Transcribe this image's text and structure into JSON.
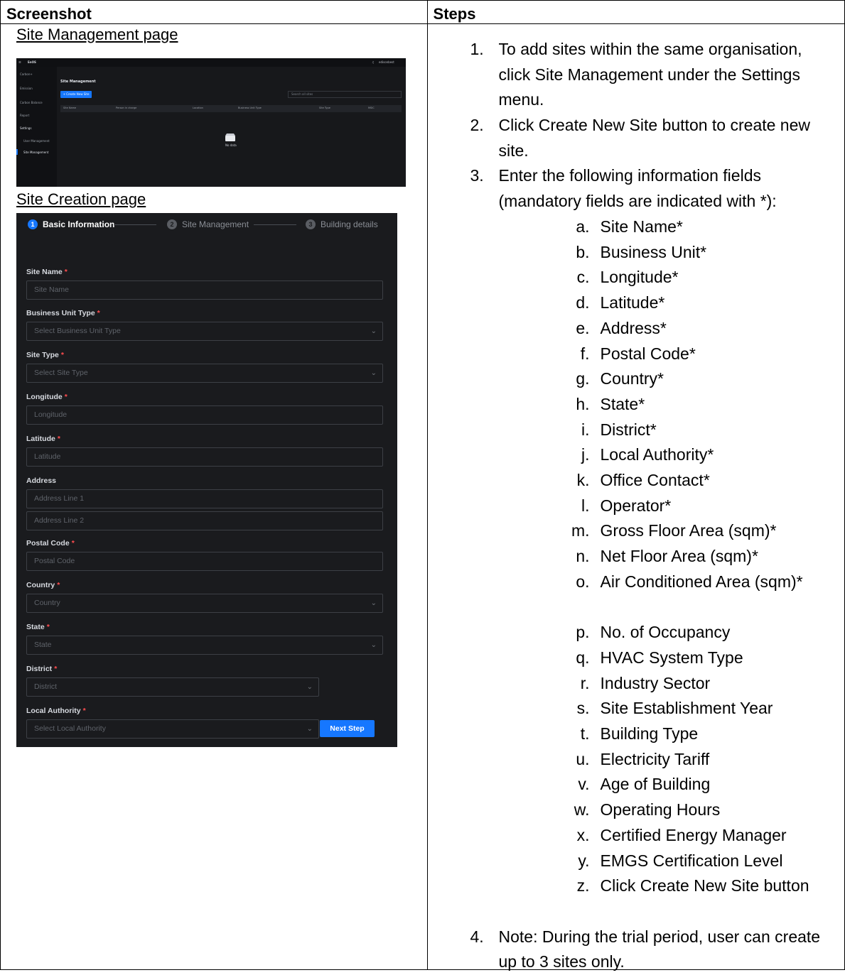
{
  "table": {
    "header_left": "Screenshot",
    "header_right": "Steps"
  },
  "left": {
    "site_management_title": "Site Management page",
    "site_creation_title": "Site Creation page"
  },
  "site_management_shot": {
    "logo": "EnOS",
    "user": "edisonbest",
    "page_title": "Site Management",
    "create_button": "+ Create New Site",
    "search_placeholder": "Search all sites",
    "sidebar_items": [
      "Carbon+",
      "Emission",
      "Carbon Balance",
      "Report",
      "Settings",
      "User Management",
      "Site Management"
    ],
    "columns": [
      "Site Name",
      "Person in charge",
      "Location",
      "Business Unit Type",
      "Site Type",
      "MSIC"
    ],
    "empty_text": "No data"
  },
  "site_creation_shot": {
    "steps": [
      {
        "num": "1",
        "label": "Basic Information"
      },
      {
        "num": "2",
        "label": "Site Management"
      },
      {
        "num": "3",
        "label": "Building details"
      }
    ],
    "fields": {
      "site_name": {
        "label": "Site Name",
        "placeholder": "Site Name"
      },
      "business_unit_type": {
        "label": "Business Unit Type",
        "placeholder": "Select Business Unit Type"
      },
      "site_type": {
        "label": "Site Type",
        "placeholder": "Select Site Type"
      },
      "longitude": {
        "label": "Longitude",
        "placeholder": "Longitude"
      },
      "latitude": {
        "label": "Latitude",
        "placeholder": "Latitude"
      },
      "address": {
        "label": "Address",
        "placeholder1": "Address Line 1",
        "placeholder2": "Address Line 2"
      },
      "postal_code": {
        "label": "Postal Code",
        "placeholder": "Postal Code"
      },
      "country": {
        "label": "Country",
        "placeholder": "Country"
      },
      "state": {
        "label": "State",
        "placeholder": "State"
      },
      "district": {
        "label": "District",
        "placeholder": "District"
      },
      "local_authority": {
        "label": "Local Authority",
        "placeholder": "Select Local Authority"
      }
    },
    "required_mark": "*",
    "next_button": "Next Step"
  },
  "steps": {
    "step1_num": "1.",
    "step1_text": "To add sites within the same organisation, click Site Management under the Settings menu.",
    "step2_num": "2.",
    "step2_text": "Click Create New Site button to create new site.",
    "step3_num": "3.",
    "step3_text": "Enter the following information fields (mandatory fields are indicated with *):",
    "sub": [
      {
        "letter": "a.",
        "text": "Site Name*"
      },
      {
        "letter": "b.",
        "text": "Business Unit*"
      },
      {
        "letter": "c.",
        "text": "Longitude*"
      },
      {
        "letter": "d.",
        "text": "Latitude*"
      },
      {
        "letter": "e.",
        "text": "Address*"
      },
      {
        "letter": "f.",
        "text": "Postal Code*"
      },
      {
        "letter": "g.",
        "text": "Country*"
      },
      {
        "letter": "h.",
        "text": "State*"
      },
      {
        "letter": "i.",
        "text": "District*"
      },
      {
        "letter": "j.",
        "text": "Local Authority*"
      },
      {
        "letter": "k.",
        "text": "Office Contact*"
      },
      {
        "letter": "l.",
        "text": "Operator*"
      },
      {
        "letter": "m.",
        "text": "Gross Floor Area (sqm)*"
      },
      {
        "letter": "n.",
        "text": "Net Floor Area (sqm)*"
      },
      {
        "letter": "o.",
        "text": "Air Conditioned Area (sqm)*"
      },
      {
        "letter": "p.",
        "text": "No. of Occupancy"
      },
      {
        "letter": "q.",
        "text": "HVAC System Type"
      },
      {
        "letter": "r.",
        "text": "Industry Sector"
      },
      {
        "letter": "s.",
        "text": "Site Establishment Year"
      },
      {
        "letter": "t.",
        "text": "Building Type"
      },
      {
        "letter": "u.",
        "text": "Electricity Tariff"
      },
      {
        "letter": "v.",
        "text": "Age of Building"
      },
      {
        "letter": "w.",
        "text": "Operating Hours"
      },
      {
        "letter": "x.",
        "text": "Certified Energy Manager"
      },
      {
        "letter": "y.",
        "text": "EMGS Certification Level"
      },
      {
        "letter": "z.",
        "text": "Click Create New Site button"
      }
    ],
    "step4_num": "4.",
    "step4_text": "Note: During the trial period, user can create up to 3 sites only."
  }
}
